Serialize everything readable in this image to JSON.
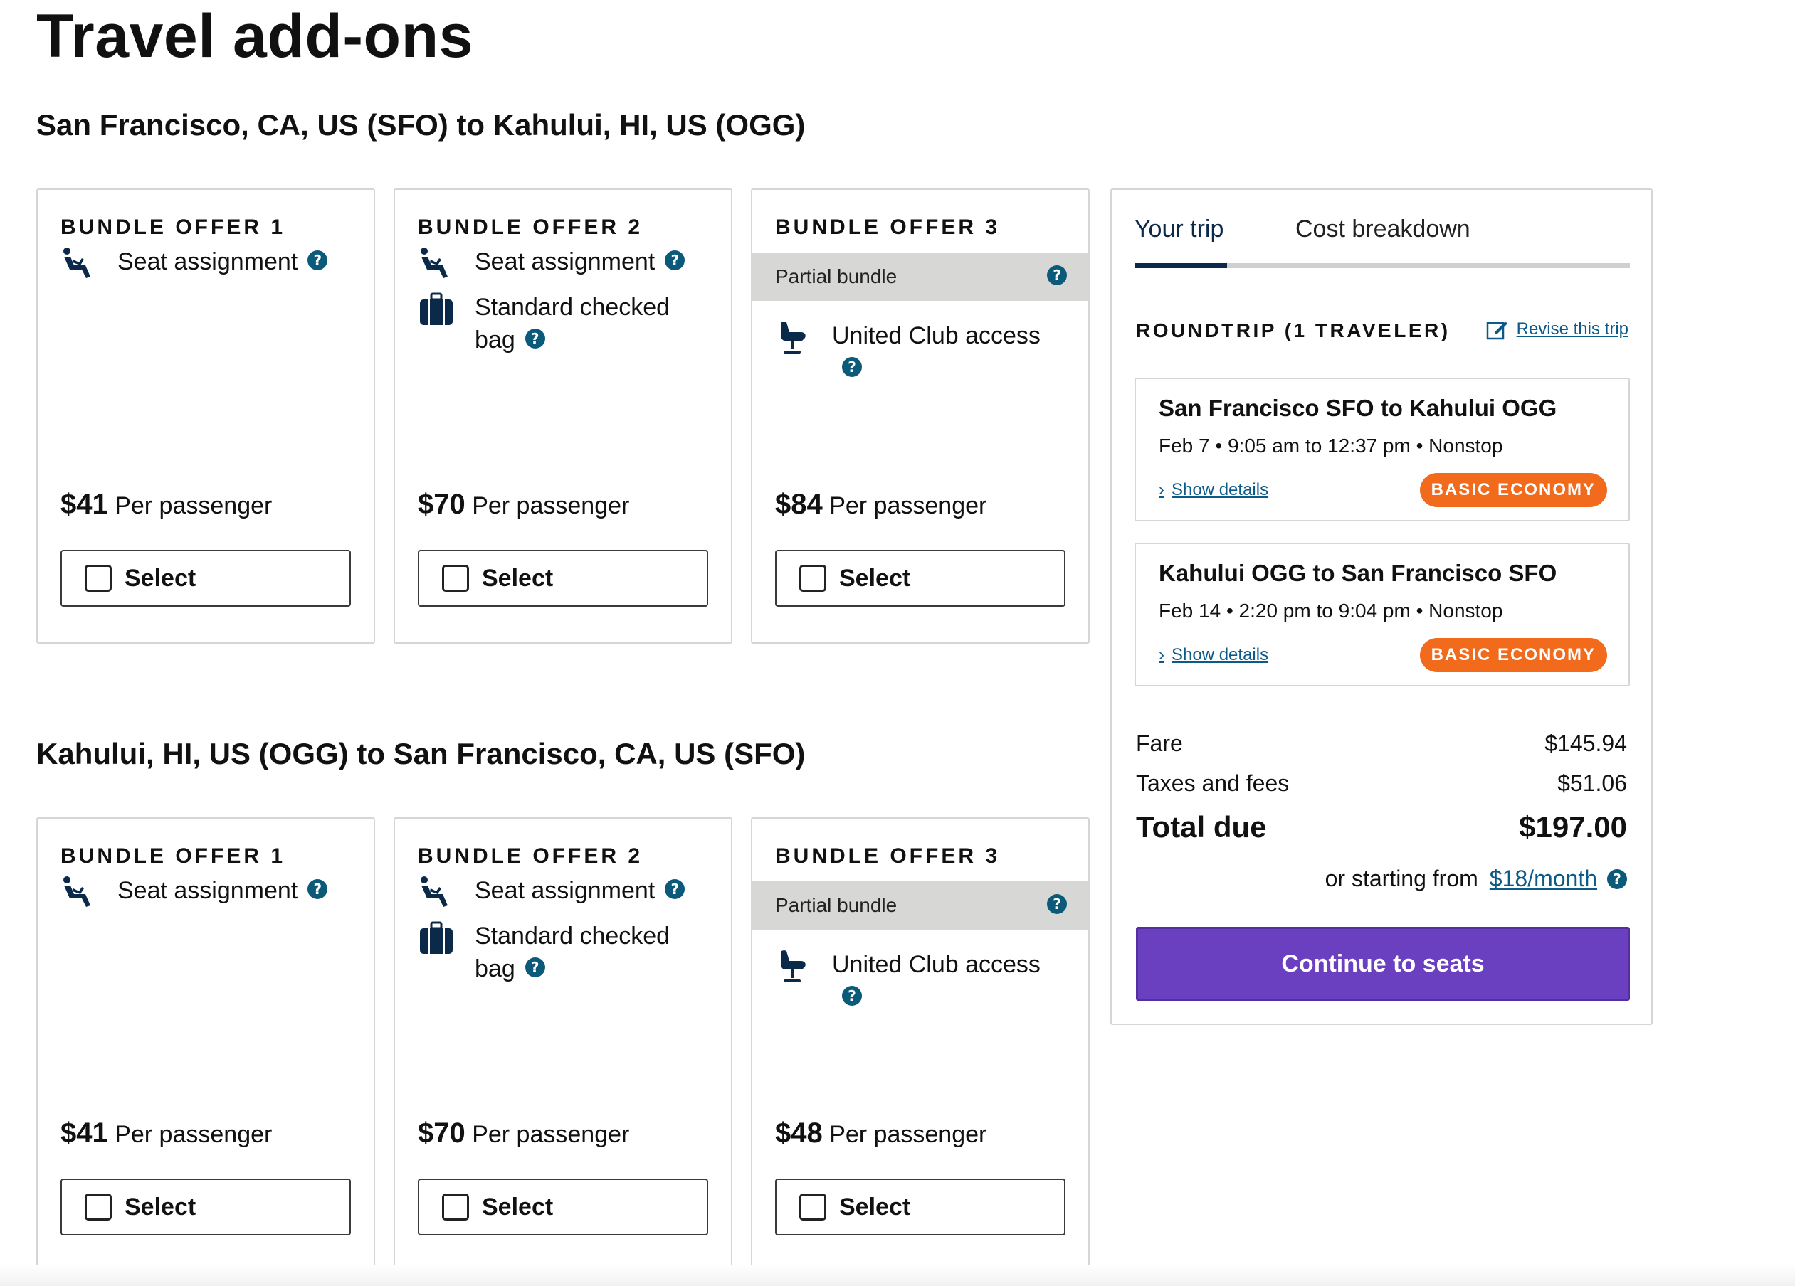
{
  "page": {
    "title": "Travel add-ons"
  },
  "routes": [
    {
      "title": "San Francisco, CA, US (SFO) to Kahului, HI, US (OGG)",
      "offers": [
        {
          "head": "BUNDLE OFFER 1",
          "partial": "",
          "features": [
            {
              "icon": "seat-icon",
              "label": "Seat assignment"
            }
          ],
          "price": "$41",
          "price_unit": "Per passenger",
          "select_label": "Select"
        },
        {
          "head": "BUNDLE OFFER 2",
          "partial": "",
          "features": [
            {
              "icon": "seat-icon",
              "label": "Seat assignment"
            },
            {
              "icon": "suitcase-icon",
              "label": "Standard checked bag"
            }
          ],
          "price": "$70",
          "price_unit": "Per passenger",
          "select_label": "Select"
        },
        {
          "head": "BUNDLE OFFER 3",
          "partial": "Partial bundle",
          "features": [
            {
              "icon": "lounge-chair-icon",
              "label": "United Club access"
            }
          ],
          "price": "$84",
          "price_unit": "Per passenger",
          "select_label": "Select"
        }
      ]
    },
    {
      "title": "Kahului, HI, US (OGG) to San Francisco, CA, US (SFO)",
      "offers": [
        {
          "head": "BUNDLE OFFER 1",
          "partial": "",
          "features": [
            {
              "icon": "seat-icon",
              "label": "Seat assignment"
            }
          ],
          "price": "$41",
          "price_unit": "Per passenger",
          "select_label": "Select"
        },
        {
          "head": "BUNDLE OFFER 2",
          "partial": "",
          "features": [
            {
              "icon": "seat-icon",
              "label": "Seat assignment"
            },
            {
              "icon": "suitcase-icon",
              "label": "Standard checked bag"
            }
          ],
          "price": "$70",
          "price_unit": "Per passenger",
          "select_label": "Select"
        },
        {
          "head": "BUNDLE OFFER 3",
          "partial": "Partial bundle",
          "features": [
            {
              "icon": "lounge-chair-icon",
              "label": "United Club access"
            }
          ],
          "price": "$48",
          "price_unit": "Per passenger",
          "select_label": "Select"
        }
      ]
    }
  ],
  "trip": {
    "tabs": [
      "Your trip",
      "Cost breakdown"
    ],
    "roundtrip_label": "ROUNDTRIP (1 TRAVELER)",
    "revise_label": "Revise this trip",
    "segments": [
      {
        "title": "San Francisco SFO to Kahului OGG",
        "subtitle": "Feb 7 • 9:05 am to 12:37 pm • Nonstop",
        "details_label": "Show details",
        "badge": "BASIC ECONOMY"
      },
      {
        "title": "Kahului OGG to San Francisco SFO",
        "subtitle": "Feb 14 • 2:20 pm to 9:04 pm • Nonstop",
        "details_label": "Show details",
        "badge": "BASIC ECONOMY"
      }
    ],
    "fare_label": "Fare",
    "fare_value": "$145.94",
    "taxes_label": "Taxes and fees",
    "taxes_value": "$51.06",
    "total_label": "Total due",
    "total_value": "$197.00",
    "finance_prefix": "or starting from",
    "finance_link": "$18/month",
    "continue_label": "Continue to seats"
  },
  "colors": {
    "accent_purple": "#6a3fc0",
    "badge_orange": "#f26a1b",
    "link_blue": "#0c5a8a",
    "navy": "#0b2a4a",
    "info_teal": "#0c5a7a"
  }
}
